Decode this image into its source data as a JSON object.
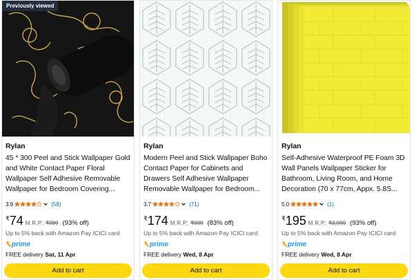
{
  "badge": "Previously viewed",
  "colors": {
    "accent_button": "#ffd814",
    "star": "#de7921",
    "link": "#007185",
    "prime_blue": "#1a98ff"
  },
  "products": [
    {
      "brand": "Rylan",
      "title": "45 * 300 Peel and Stick Wallpaper Gold and White Contact Paper Floral Wallpaper Self Adhesive Removable Wallpaper for Bedroom Covering...",
      "rating": "3.9",
      "rating_value": 3.9,
      "reviews": "(58)",
      "currency": "₹",
      "price": "74",
      "mrp_label": "M.R.P:",
      "mrp": "₹999",
      "discount": "(93% off)",
      "cashback": "Up to 5% back with Amazon Pay ICICI card",
      "prime": "prime",
      "delivery_prefix": "FREE delivery",
      "delivery_date": "Sat, 11 Apr",
      "cart_label": "Add to cart",
      "image_icon": "black-gold-floral-wallpaper-roll"
    },
    {
      "brand": "Rylan",
      "title": "Modern Peel and Stick Wallpaper Boho Contact Paper for Cabinets and Drawers Self Adhesive Wallpaper Removable Wallpaper for Bedroom...",
      "rating": "3.7",
      "rating_value": 3.7,
      "reviews": "(71)",
      "currency": "₹",
      "price": "174",
      "mrp_label": "M.R.P:",
      "mrp": "₹999",
      "discount": "(83% off)",
      "cashback": "Up to 5% back with Amazon Pay ICICI card",
      "prime": "prime",
      "delivery_prefix": "FREE delivery",
      "delivery_date": "Wed, 8 Apr",
      "cart_label": "Add to cart",
      "image_icon": "green-hexagon-leaf-pattern"
    },
    {
      "brand": "Rylan",
      "title": "Self-Adhesive Waterproof PE Foam 3D Wall Panels Wallpaper Sticker for Bathroom, Living Room, and Home Decoration (70 x 77cm, Appx. 5.8S...",
      "rating": "5.0",
      "rating_value": 5.0,
      "reviews": "(1)",
      "currency": "₹",
      "price": "195",
      "mrp_label": "M.R.P:",
      "mrp": "₹2,999",
      "discount": "(93% off)",
      "cashback": "Up to 5% back with Amazon Pay ICICI card",
      "prime": "prime",
      "delivery_prefix": "FREE delivery",
      "delivery_date": "Wed, 8 Apr",
      "cart_label": "Add to cart",
      "image_icon": "yellow-3d-brick-foam-panels"
    }
  ]
}
